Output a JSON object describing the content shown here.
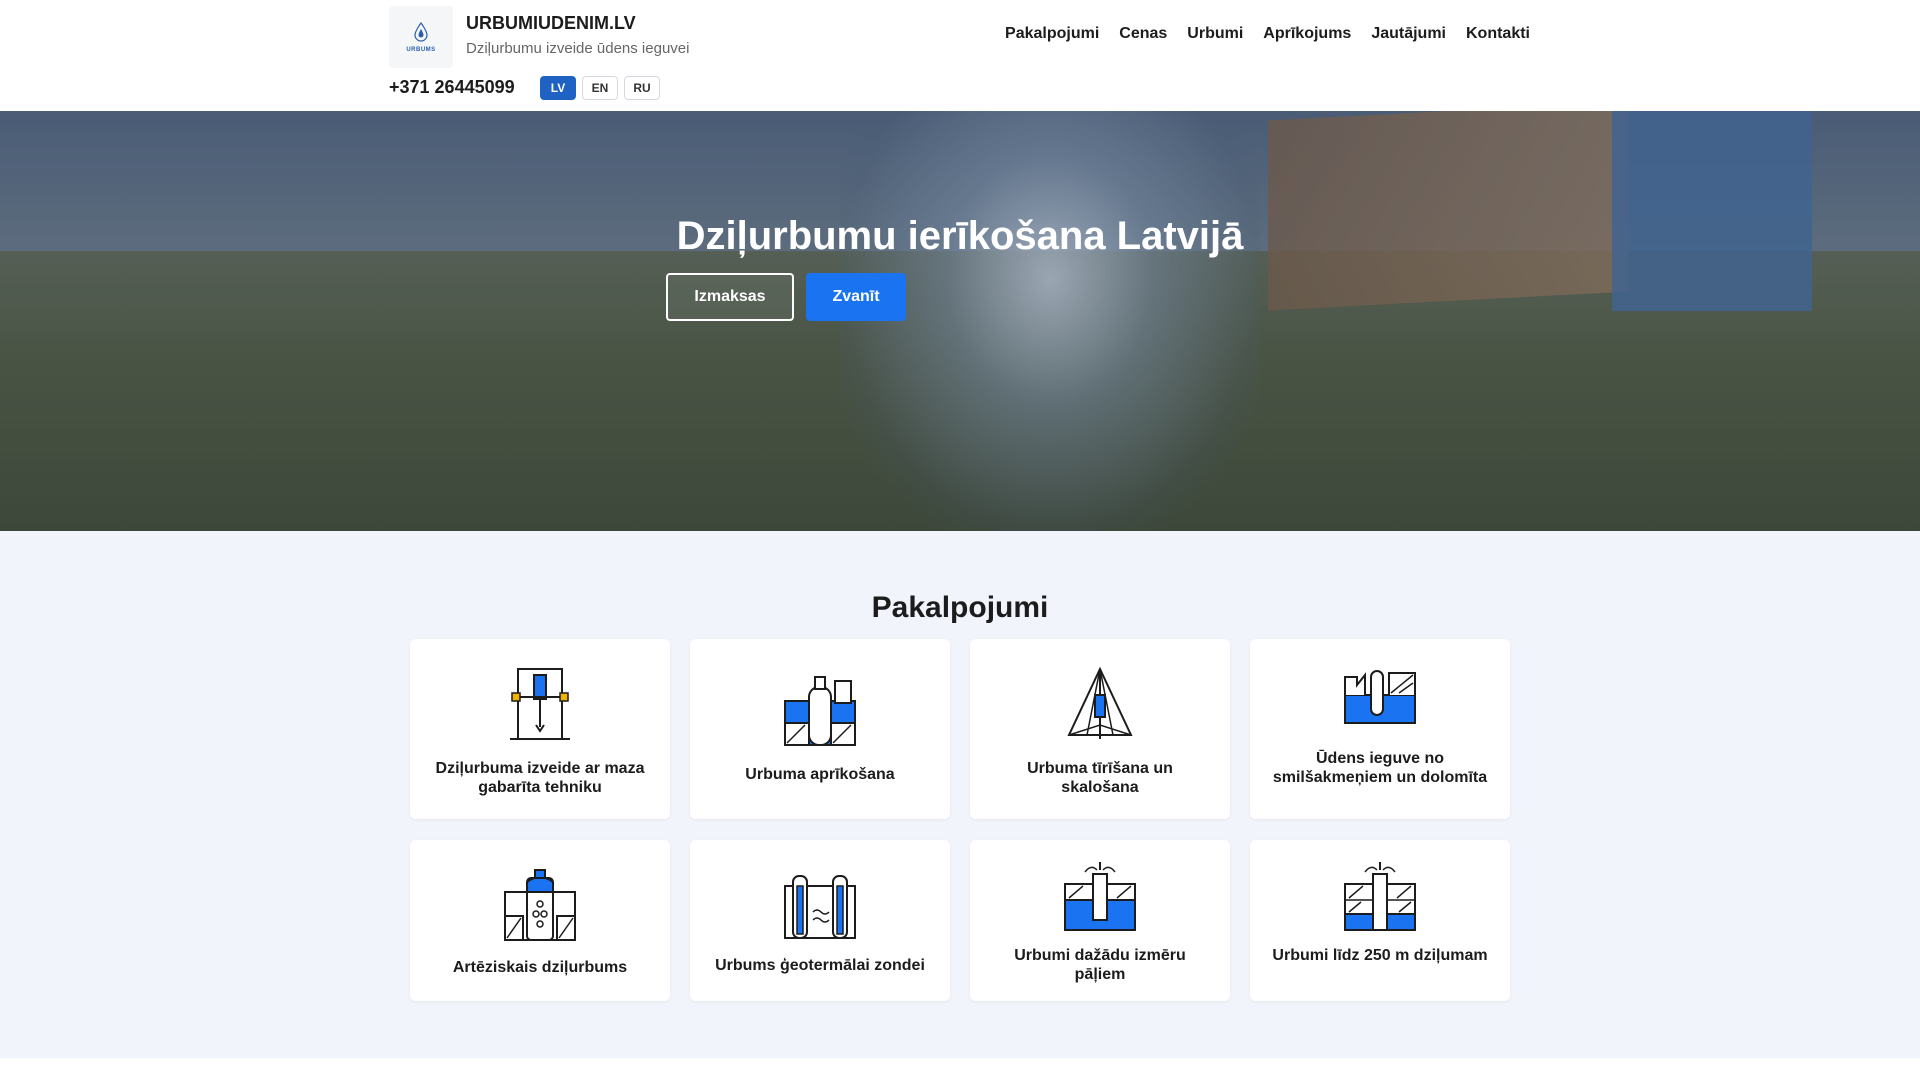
{
  "header": {
    "logo_text": "URBUMS",
    "brand_name": "URBUMIUDENIM.LV",
    "tagline": "Dziļurbumu izveide ūdens ieguvei",
    "phone": "+371 26445099",
    "nav": [
      "Pakalpojumi",
      "Cenas",
      "Urbumi",
      "Aprīkojums",
      "Jautājumi",
      "Kontakti"
    ],
    "languages": [
      {
        "code": "LV",
        "active": true
      },
      {
        "code": "EN",
        "active": false
      },
      {
        "code": "RU",
        "active": false
      }
    ]
  },
  "hero": {
    "title": "Dziļurbumu ierīkošana Latvijā",
    "btn_prices": "Izmaksas",
    "btn_call": "Zvanīt"
  },
  "services": {
    "title": "Pakalpojumi",
    "cards": [
      {
        "label": "Dziļurbuma izveide ar maza gabarīta tehniku",
        "icon": "small-drill-rig-icon"
      },
      {
        "label": "Urbuma aprīkošana",
        "icon": "well-equipment-icon"
      },
      {
        "label": "Urbuma tīrīšana un skalošana",
        "icon": "well-cleaning-icon"
      },
      {
        "label": "Ūdens ieguve no smilšakmeņiem un dolomīta",
        "icon": "sandstone-water-icon"
      },
      {
        "label": "Artēziskais dziļurbums",
        "icon": "artesian-well-icon"
      },
      {
        "label": "Urbums ģeotermālai zondei",
        "icon": "geothermal-probe-icon"
      },
      {
        "label": "Urbumi dažādu izmēru pāļiem",
        "icon": "pile-drilling-icon"
      },
      {
        "label": "Urbumi līdz 250 m dziļumam",
        "icon": "deep-well-icon"
      }
    ]
  },
  "colors": {
    "accent": "#1a73f0",
    "lang_active": "#1e63c4",
    "icon_blue": "#1a73f0",
    "services_bg": "#f1f4fa"
  }
}
